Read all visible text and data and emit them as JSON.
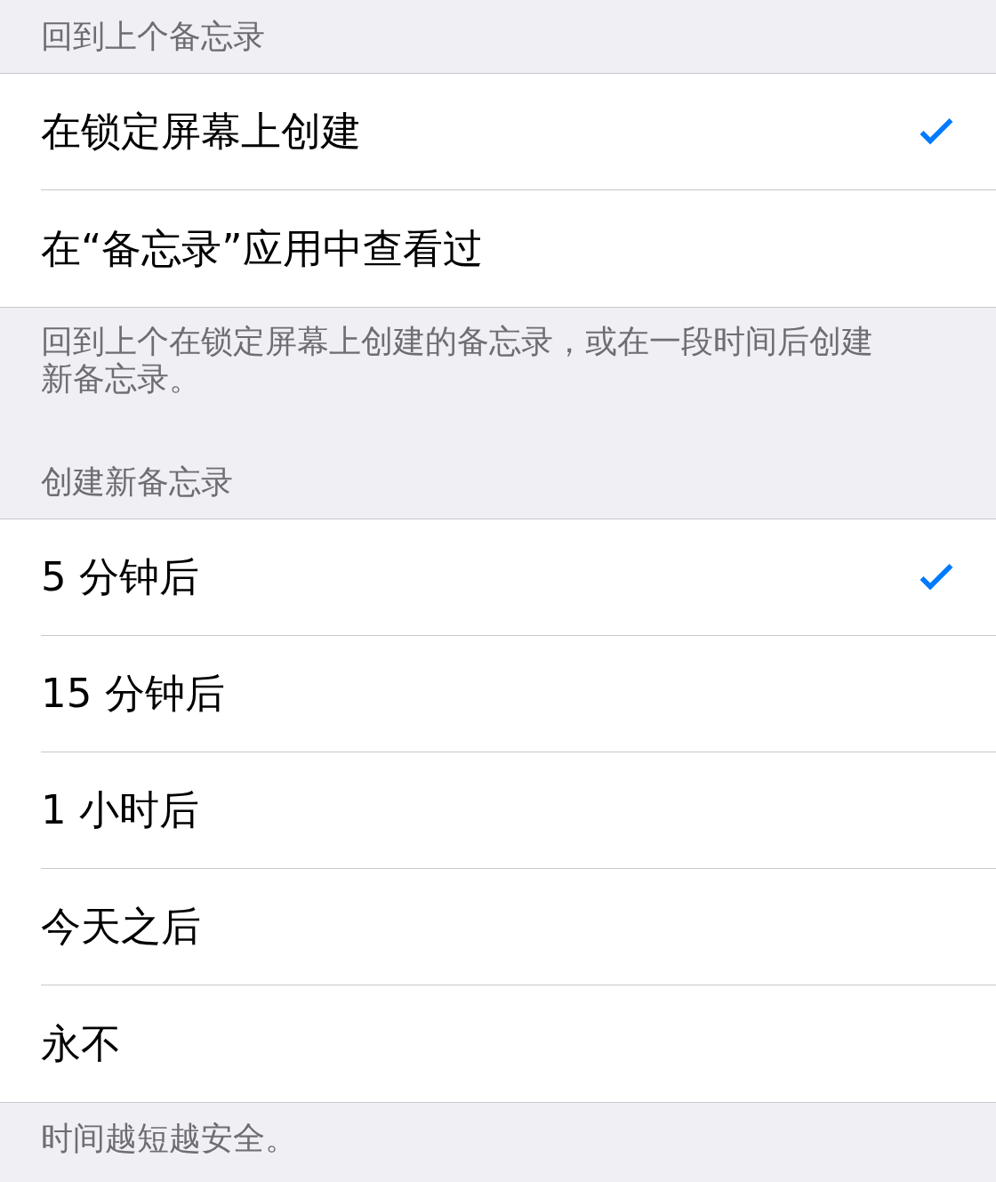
{
  "sections": [
    {
      "header": "回到上个备忘录",
      "options": [
        {
          "label": "在锁定屏幕上创建",
          "selected": true
        },
        {
          "label": "在“备忘录”应用中查看过",
          "selected": false
        }
      ],
      "footer": "回到上个在锁定屏幕上创建的备忘录，或在一段时间后创建新备忘录。"
    },
    {
      "header": "创建新备忘录",
      "options": [
        {
          "label": "5 分钟后",
          "selected": true
        },
        {
          "label": "15 分钟后",
          "selected": false
        },
        {
          "label": "1 小时后",
          "selected": false
        },
        {
          "label": "今天之后",
          "selected": false
        },
        {
          "label": "永不",
          "selected": false
        }
      ],
      "footer": "时间越短越安全。"
    }
  ]
}
